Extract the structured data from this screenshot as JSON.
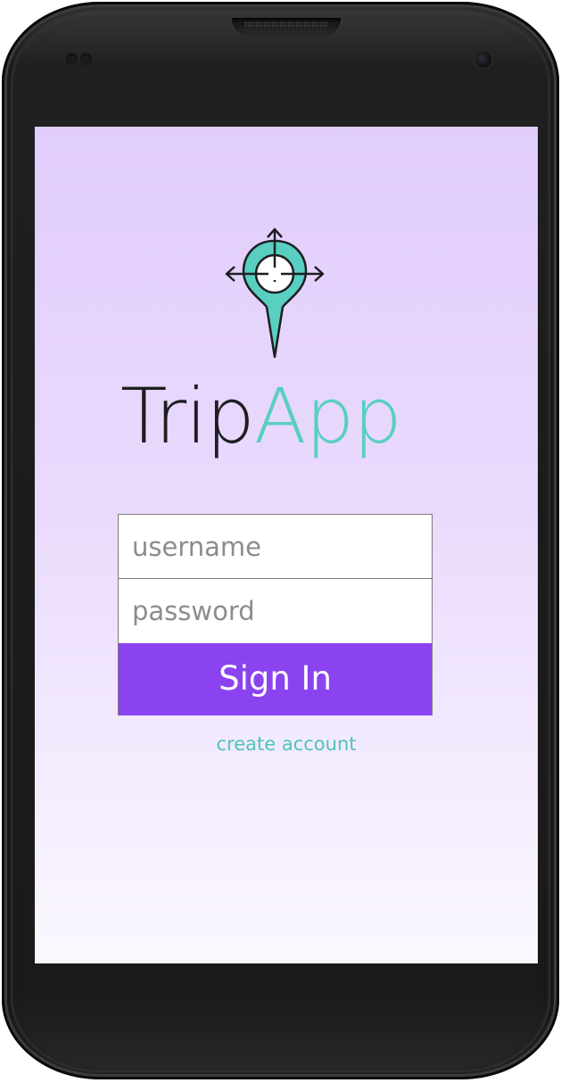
{
  "app": {
    "brand_part1": "Trip",
    "brand_part2": "App",
    "logo_icon": "location-pin-crosshair-icon"
  },
  "login": {
    "username_placeholder": "username",
    "password_placeholder": "password",
    "signin_label": "Sign In",
    "create_account_label": "create account"
  },
  "colors": {
    "accent_teal": "#58cfc0",
    "button_purple": "#8b43f0",
    "screen_top": "#e0cdfc",
    "screen_bottom": "#fbf8ff",
    "brand_dark": "#1e1e22"
  }
}
